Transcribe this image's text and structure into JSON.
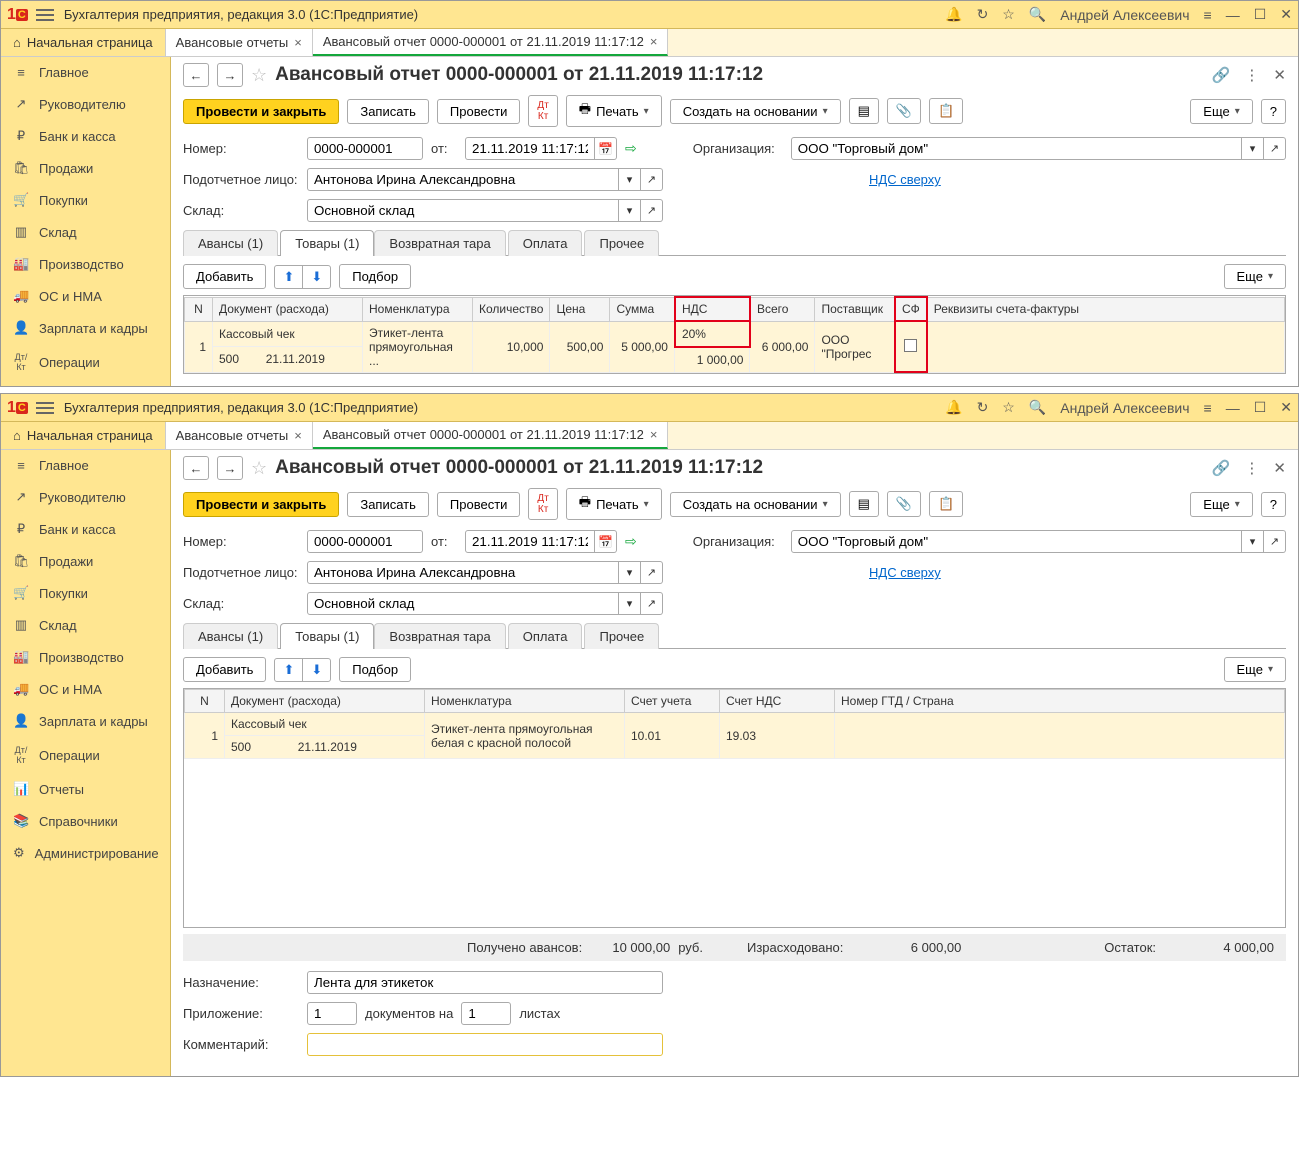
{
  "app": {
    "title": "Бухгалтерия предприятия, редакция 3.0  (1С:Предприятие)",
    "user": "Андрей Алексеевич"
  },
  "tabs": {
    "home": "Начальная страница",
    "list": "Авансовые отчеты",
    "doc": "Авансовый отчет 0000-000001 от 21.11.2019 11:17:12"
  },
  "sidebar": {
    "items": [
      {
        "label": "Главное",
        "icon": "≡"
      },
      {
        "label": "Руководителю",
        "icon": "↗"
      },
      {
        "label": "Банк и касса",
        "icon": "₽"
      },
      {
        "label": "Продажи",
        "icon": "🛍"
      },
      {
        "label": "Покупки",
        "icon": "🛒"
      },
      {
        "label": "Склад",
        "icon": "▥"
      },
      {
        "label": "Производство",
        "icon": "🏭"
      },
      {
        "label": "ОС и НМА",
        "icon": "🚚"
      },
      {
        "label": "Зарплата и кадры",
        "icon": "👤"
      },
      {
        "label": "Операции",
        "icon": "Дт/Кт"
      },
      {
        "label": "Отчеты",
        "icon": "📊"
      },
      {
        "label": "Справочники",
        "icon": "📚"
      },
      {
        "label": "Администрирование",
        "icon": "⚙"
      }
    ]
  },
  "doc": {
    "title": "Авансовый отчет 0000-000001 от 21.11.2019 11:17:12",
    "actions": {
      "post_close": "Провести и закрыть",
      "save": "Записать",
      "post": "Провести",
      "print": "Печать",
      "create_basis": "Создать на основании",
      "more": "Еще"
    },
    "fields": {
      "number_label": "Номер:",
      "number": "0000-000001",
      "from_label": "от:",
      "date": "21.11.2019 11:17:12",
      "org_label": "Организация:",
      "org": "ООО \"Торговый дом\"",
      "person_label": "Подотчетное лицо:",
      "person": "Антонова Ирина Александровна",
      "vat_link": "НДС сверху",
      "warehouse_label": "Склад:",
      "warehouse": "Основной склад"
    },
    "inner_tabs": {
      "advances": "Авансы (1)",
      "goods": "Товары (1)",
      "returnable": "Возвратная тара",
      "payment": "Оплата",
      "other": "Прочее"
    },
    "sub_actions": {
      "add": "Добавить",
      "select": "Подбор",
      "more": "Еще"
    }
  },
  "table1": {
    "headers": {
      "n": "N",
      "doc": "Документ (расхода)",
      "nomen": "Номенклатура",
      "qty": "Количество",
      "price": "Цена",
      "sum": "Сумма",
      "vat": "НДС",
      "total": "Всего",
      "supplier": "Поставщик",
      "sf": "СФ",
      "requisites": "Реквизиты счета-фактуры"
    },
    "row": {
      "n": "1",
      "doc_top": "Кассовый чек",
      "doc_num": "500",
      "doc_date": "21.11.2019",
      "nomen": "Этикет-лента прямоугольная ...",
      "qty": "10,000",
      "price": "500,00",
      "sum": "5 000,00",
      "vat_rate": "20%",
      "vat_sum": "1 000,00",
      "total": "6 000,00",
      "supplier": "ООО \"Прогрес"
    }
  },
  "table2": {
    "headers": {
      "n": "N",
      "doc": "Документ (расхода)",
      "nomen": "Номенклатура",
      "account": "Счет учета",
      "vat_account": "Счет НДС",
      "gtd": "Номер ГТД / Страна"
    },
    "row": {
      "n": "1",
      "doc_top": "Кассовый чек",
      "doc_num": "500",
      "doc_date": "21.11.2019",
      "nomen": "Этикет-лента прямоугольная белая с красной полосой",
      "account": "10.01",
      "vat_account": "19.03"
    }
  },
  "totals": {
    "received_label": "Получено авансов:",
    "received": "10 000,00",
    "currency": "руб.",
    "spent_label": "Израсходовано:",
    "spent": "6 000,00",
    "rest_label": "Остаток:",
    "rest": "4 000,00"
  },
  "footer": {
    "purpose_label": "Назначение:",
    "purpose": "Лента для этикеток",
    "attach_label": "Приложение:",
    "docs_count": "1",
    "docs_on": "документов на",
    "sheets": "1",
    "sheets_label": "листах",
    "comment_label": "Комментарий:"
  }
}
